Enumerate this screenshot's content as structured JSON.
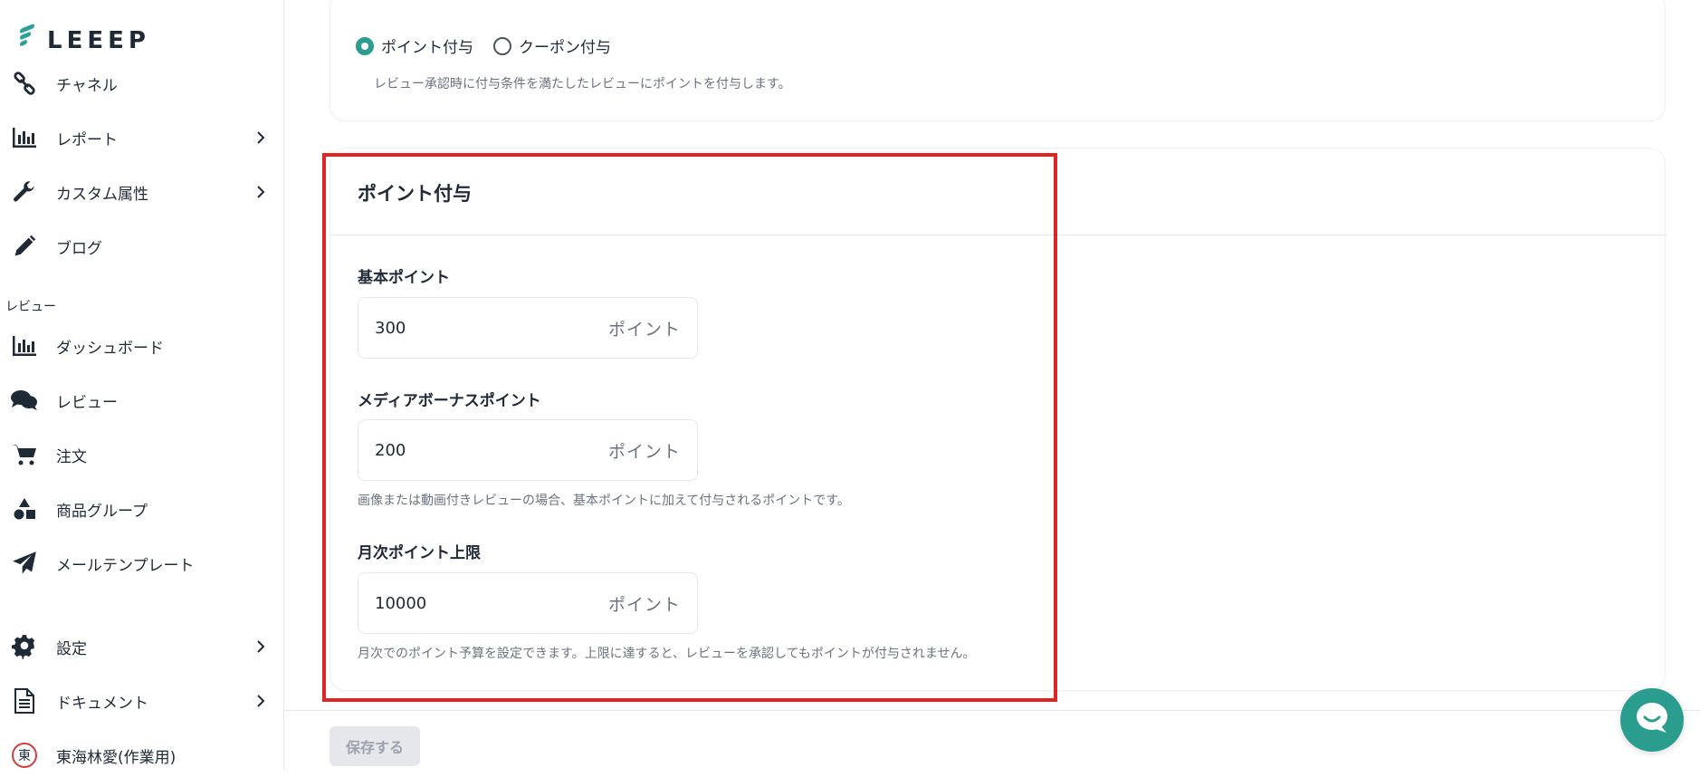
{
  "brand": {
    "name": "LEEEP",
    "color": "#2aa198"
  },
  "sidebar": {
    "items_top": [
      {
        "label": "チャネル",
        "icon": "link-icon"
      },
      {
        "label": "レポート",
        "icon": "bar-chart-icon",
        "has_children": true
      },
      {
        "label": "カスタム属性",
        "icon": "wrench-icon",
        "has_children": true
      },
      {
        "label": "ブログ",
        "icon": "pencil-icon"
      }
    ],
    "section_review": "レビュー",
    "items_review": [
      {
        "label": "ダッシュボード",
        "icon": "bar-chart-icon"
      },
      {
        "label": "レビュー",
        "icon": "comments-icon"
      },
      {
        "label": "注文",
        "icon": "cart-icon"
      },
      {
        "label": "商品グループ",
        "icon": "shapes-icon"
      },
      {
        "label": "メールテンプレート",
        "icon": "paper-plane-icon"
      }
    ],
    "items_bottom": [
      {
        "label": "設定",
        "icon": "gear-icon",
        "has_children": true
      },
      {
        "label": "ドキュメント",
        "icon": "document-icon",
        "has_children": true
      }
    ],
    "user": {
      "avatar_char": "東",
      "name": "東海林愛(作業用)"
    }
  },
  "grant_type": {
    "options": [
      {
        "label": "ポイント付与",
        "checked": true
      },
      {
        "label": "クーポン付与",
        "checked": false
      }
    ],
    "hint": "レビュー承認時に付与条件を満たしたレビューにポイントを付与します。"
  },
  "points_card": {
    "title": "ポイント付与",
    "base": {
      "label": "基本ポイント",
      "value": "300",
      "unit": "ポイント"
    },
    "media_bonus": {
      "label": "メディアボーナスポイント",
      "value": "200",
      "unit": "ポイント",
      "hint": "画像または動画付きレビューの場合、基本ポイントに加えて付与されるポイントです。"
    },
    "monthly_cap": {
      "label": "月次ポイント上限",
      "value": "10000",
      "unit": "ポイント",
      "hint": "月次でのポイント予算を設定できます。上限に達すると、レビューを承認してもポイントが付与されません。"
    }
  },
  "footer": {
    "save_label": "保存する"
  },
  "colors": {
    "accent": "#2a9d8f",
    "highlight": "#e02424"
  }
}
